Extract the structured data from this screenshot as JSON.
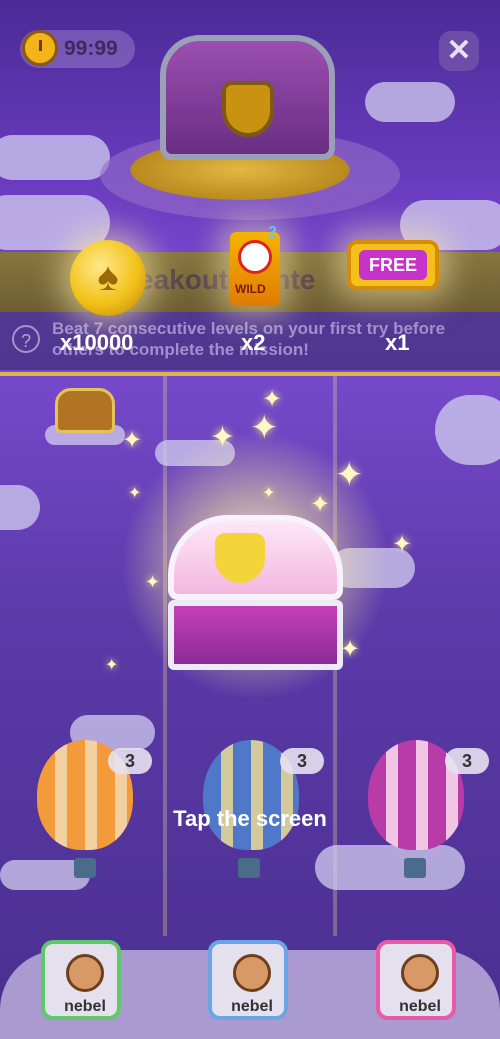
{
  "timer": {
    "value": "99:99"
  },
  "mission": {
    "title_partial": "eakout  Conte",
    "description": "Beat 7 consecutive levels on your first try before others to complete the mission!"
  },
  "rewards": [
    {
      "icon": "coin-icon",
      "quantity": "x10000"
    },
    {
      "icon": "wild-card-icon",
      "label": "WILD",
      "badge": "2",
      "quantity": "x2"
    },
    {
      "icon": "free-ticket-icon",
      "label": "FREE",
      "quantity": "x1"
    }
  ],
  "balloons": [
    {
      "color": "orange",
      "count": "3"
    },
    {
      "color": "blue",
      "count": "3"
    },
    {
      "color": "magenta",
      "count": "3"
    }
  ],
  "prompt": "Tap the screen",
  "players": [
    {
      "name": "nebel",
      "border_color": "#5fc86a"
    },
    {
      "name": "nebel",
      "border_color": "#6aa6e6"
    },
    {
      "name": "nebel",
      "border_color": "#e85aa8"
    }
  ],
  "colors": {
    "background": "#6a3cc0",
    "accent": "#f3b31a"
  }
}
